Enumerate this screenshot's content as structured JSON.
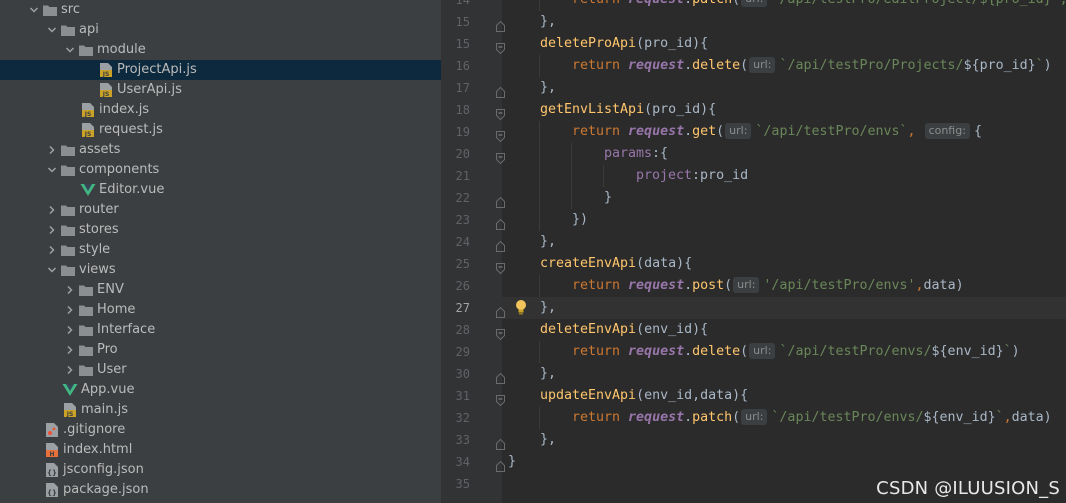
{
  "tree": [
    {
      "label": "src",
      "depth": 0,
      "arrow": "down",
      "icon": "folder"
    },
    {
      "label": "api",
      "depth": 1,
      "arrow": "down",
      "icon": "folder"
    },
    {
      "label": "module",
      "depth": 2,
      "arrow": "down",
      "icon": "folder"
    },
    {
      "label": "ProjectApi.js",
      "depth": 4,
      "arrow": "none",
      "icon": "js",
      "selected": true
    },
    {
      "label": "UserApi.js",
      "depth": 4,
      "arrow": "none",
      "icon": "js"
    },
    {
      "label": "index.js",
      "depth": 3,
      "arrow": "none",
      "icon": "js"
    },
    {
      "label": "request.js",
      "depth": 3,
      "arrow": "none",
      "icon": "js"
    },
    {
      "label": "assets",
      "depth": 1,
      "arrow": "right",
      "icon": "folder"
    },
    {
      "label": "components",
      "depth": 1,
      "arrow": "down",
      "icon": "folder"
    },
    {
      "label": "Editor.vue",
      "depth": 3,
      "arrow": "none",
      "icon": "vue"
    },
    {
      "label": "router",
      "depth": 1,
      "arrow": "right",
      "icon": "folder"
    },
    {
      "label": "stores",
      "depth": 1,
      "arrow": "right",
      "icon": "folder"
    },
    {
      "label": "style",
      "depth": 1,
      "arrow": "right",
      "icon": "folder"
    },
    {
      "label": "views",
      "depth": 1,
      "arrow": "down",
      "icon": "folder"
    },
    {
      "label": "ENV",
      "depth": 2,
      "arrow": "right",
      "icon": "folder"
    },
    {
      "label": "Home",
      "depth": 2,
      "arrow": "right",
      "icon": "folder"
    },
    {
      "label": "Interface",
      "depth": 2,
      "arrow": "right",
      "icon": "folder"
    },
    {
      "label": "Pro",
      "depth": 2,
      "arrow": "right",
      "icon": "folder"
    },
    {
      "label": "User",
      "depth": 2,
      "arrow": "right",
      "icon": "folder"
    },
    {
      "label": "App.vue",
      "depth": 2,
      "arrow": "none",
      "icon": "vue"
    },
    {
      "label": "main.js",
      "depth": 2,
      "arrow": "none",
      "icon": "js"
    },
    {
      "label": ".gitignore",
      "depth": 1,
      "arrow": "none",
      "icon": "git"
    },
    {
      "label": "index.html",
      "depth": 1,
      "arrow": "none",
      "icon": "html"
    },
    {
      "label": "jsconfig.json",
      "depth": 1,
      "arrow": "none",
      "icon": "json"
    },
    {
      "label": "package.json",
      "depth": 1,
      "arrow": "none",
      "icon": "json"
    }
  ],
  "editor": {
    "current_line": "27",
    "lines": [
      {
        "num": "14",
        "indent": 2,
        "fold": "none",
        "tokens": [
          {
            "t": "return ",
            "c": "kw"
          },
          {
            "t": "request",
            "c": "obj"
          },
          {
            "t": ".",
            "c": ""
          },
          {
            "t": "patch",
            "c": "meth"
          },
          {
            "t": "(",
            "c": ""
          },
          {
            "t": "url:",
            "c": "hint"
          },
          {
            "t": "`/api/testPro/editProject/${pro_id}`,da",
            "c": "str"
          }
        ]
      },
      {
        "num": "15",
        "indent": 1,
        "fold": "end",
        "tokens": [
          {
            "t": "},",
            "c": ""
          }
        ]
      },
      {
        "num": "15",
        "indent": 1,
        "fold": "start",
        "tokens": [
          {
            "t": "deleteProApi",
            "c": "fn"
          },
          {
            "t": "(pro_id){",
            "c": ""
          }
        ]
      },
      {
        "num": "16",
        "indent": 2,
        "fold": "none",
        "tokens": [
          {
            "t": "return ",
            "c": "kw"
          },
          {
            "t": "request",
            "c": "obj"
          },
          {
            "t": ".",
            "c": ""
          },
          {
            "t": "delete",
            "c": "meth"
          },
          {
            "t": "(",
            "c": ""
          },
          {
            "t": "url:",
            "c": "hint"
          },
          {
            "t": "`/api/testPro/Projects/",
            "c": "str"
          },
          {
            "t": "${pro_id}",
            "c": ""
          },
          {
            "t": "`",
            "c": "str"
          },
          {
            "t": ")",
            "c": ""
          }
        ]
      },
      {
        "num": "17",
        "indent": 1,
        "fold": "end",
        "tokens": [
          {
            "t": "},",
            "c": ""
          }
        ]
      },
      {
        "num": "18",
        "indent": 1,
        "fold": "start",
        "tokens": [
          {
            "t": "getEnvListApi",
            "c": "fn"
          },
          {
            "t": "(pro_id){",
            "c": ""
          }
        ]
      },
      {
        "num": "19",
        "indent": 2,
        "fold": "start",
        "tokens": [
          {
            "t": "return ",
            "c": "kw"
          },
          {
            "t": "request",
            "c": "obj"
          },
          {
            "t": ".",
            "c": ""
          },
          {
            "t": "get",
            "c": "meth"
          },
          {
            "t": "(",
            "c": ""
          },
          {
            "t": "url:",
            "c": "hint"
          },
          {
            "t": "`/api/testPro/envs`",
            "c": "str"
          },
          {
            "t": ",",
            "c": "kw"
          },
          {
            "t": " ",
            "c": ""
          },
          {
            "t": "config:",
            "c": "hint"
          },
          {
            "t": "{",
            "c": ""
          }
        ]
      },
      {
        "num": "20",
        "indent": 3,
        "fold": "start",
        "tokens": [
          {
            "t": "params",
            "c": "prop"
          },
          {
            "t": ":{",
            "c": ""
          }
        ]
      },
      {
        "num": "21",
        "indent": 4,
        "fold": "none",
        "tokens": [
          {
            "t": "project",
            "c": "prop"
          },
          {
            "t": ":pro_id",
            "c": ""
          }
        ]
      },
      {
        "num": "22",
        "indent": 3,
        "fold": "end",
        "tokens": [
          {
            "t": "}",
            "c": ""
          }
        ]
      },
      {
        "num": "23",
        "indent": 2,
        "fold": "end",
        "tokens": [
          {
            "t": "})",
            "c": ""
          }
        ]
      },
      {
        "num": "24",
        "indent": 1,
        "fold": "end",
        "tokens": [
          {
            "t": "},",
            "c": ""
          }
        ]
      },
      {
        "num": "25",
        "indent": 1,
        "fold": "start",
        "tokens": [
          {
            "t": "createEnvApi",
            "c": "fn"
          },
          {
            "t": "(data){",
            "c": ""
          }
        ]
      },
      {
        "num": "26",
        "indent": 2,
        "fold": "none",
        "tokens": [
          {
            "t": "return ",
            "c": "kw"
          },
          {
            "t": "request",
            "c": "obj"
          },
          {
            "t": ".",
            "c": ""
          },
          {
            "t": "post",
            "c": "meth"
          },
          {
            "t": "(",
            "c": ""
          },
          {
            "t": "url:",
            "c": "hint"
          },
          {
            "t": "'/api/testPro/envs'",
            "c": "str"
          },
          {
            "t": ",",
            "c": "kw"
          },
          {
            "t": "data)",
            "c": ""
          }
        ]
      },
      {
        "num": "27",
        "indent": 1,
        "fold": "end",
        "tokens": [
          {
            "t": "},",
            "c": ""
          }
        ]
      },
      {
        "num": "28",
        "indent": 1,
        "fold": "start",
        "tokens": [
          {
            "t": "deleteEnvApi",
            "c": "fn"
          },
          {
            "t": "(env_id){",
            "c": ""
          }
        ]
      },
      {
        "num": "29",
        "indent": 2,
        "fold": "none",
        "tokens": [
          {
            "t": "return ",
            "c": "kw"
          },
          {
            "t": "request",
            "c": "obj"
          },
          {
            "t": ".",
            "c": ""
          },
          {
            "t": "delete",
            "c": "meth"
          },
          {
            "t": "(",
            "c": ""
          },
          {
            "t": "url:",
            "c": "hint"
          },
          {
            "t": "`/api/testPro/envs/",
            "c": "str"
          },
          {
            "t": "${env_id}",
            "c": ""
          },
          {
            "t": "`",
            "c": "str"
          },
          {
            "t": ")",
            "c": ""
          }
        ]
      },
      {
        "num": "30",
        "indent": 1,
        "fold": "end",
        "tokens": [
          {
            "t": "},",
            "c": ""
          }
        ]
      },
      {
        "num": "31",
        "indent": 1,
        "fold": "start",
        "tokens": [
          {
            "t": "updateEnvApi",
            "c": "fn"
          },
          {
            "t": "(env_id,data){",
            "c": ""
          }
        ]
      },
      {
        "num": "32",
        "indent": 2,
        "fold": "none",
        "tokens": [
          {
            "t": "return ",
            "c": "kw"
          },
          {
            "t": "request",
            "c": "obj"
          },
          {
            "t": ".",
            "c": ""
          },
          {
            "t": "patch",
            "c": "meth"
          },
          {
            "t": "(",
            "c": ""
          },
          {
            "t": "url:",
            "c": "hint"
          },
          {
            "t": "`/api/testPro/envs/",
            "c": "str"
          },
          {
            "t": "${env_id}",
            "c": ""
          },
          {
            "t": "`",
            "c": "str"
          },
          {
            "t": ",",
            "c": "kw"
          },
          {
            "t": "data)",
            "c": ""
          }
        ]
      },
      {
        "num": "33",
        "indent": 1,
        "fold": "end",
        "tokens": [
          {
            "t": "},",
            "c": ""
          }
        ]
      },
      {
        "num": "34",
        "indent": 0,
        "fold": "end",
        "tokens": [
          {
            "t": "}",
            "c": ""
          }
        ]
      },
      {
        "num": "35",
        "indent": 0,
        "fold": "none",
        "tokens": []
      }
    ]
  },
  "watermark": "CSDN @ILUUSION_S",
  "colors": {
    "tree_bg": "#3c3f41",
    "selected_row": "#0d293e",
    "editor_bg": "#2b2b2b",
    "keyword": "#cc7832",
    "function": "#ffc66d",
    "string": "#6a8759",
    "property": "#9876aa",
    "folder": "#8c8f91"
  }
}
